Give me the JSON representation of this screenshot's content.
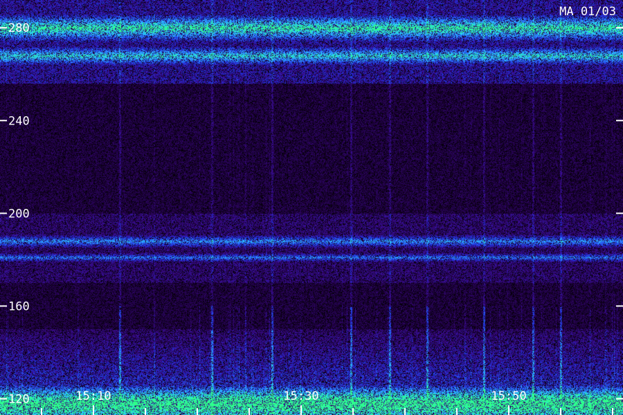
{
  "chart_data": {
    "type": "heatmap",
    "title": "MA 01/03",
    "xlabel": "",
    "ylabel": "",
    "y_axis": {
      "ticks": [
        120,
        160,
        200,
        240,
        280
      ],
      "range": [
        113,
        292
      ]
    },
    "x_axis": {
      "tick_labels": [
        "15:10",
        "15:30",
        "15:50"
      ],
      "tick_minutes": [
        10,
        30,
        50
      ],
      "range_minutes": [
        1,
        61
      ],
      "minor_step_minutes": 5
    },
    "colormap": [
      "#000000",
      "#1a0033",
      "#3a0a8a",
      "#1f2fd8",
      "#2e7bff",
      "#29d0ff",
      "#2eff8a"
    ],
    "bands": [
      {
        "center": 280,
        "width": 6,
        "intensity": 0.75
      },
      {
        "center": 268,
        "width": 4,
        "intensity": 0.6
      },
      {
        "center": 188,
        "width": 3,
        "intensity": 0.5
      },
      {
        "center": 181,
        "width": 2,
        "intensity": 0.45
      },
      {
        "center": 118,
        "width": 8,
        "intensity": 0.8
      }
    ],
    "streaks_minutes": [
      12.5,
      21.4,
      27.2,
      34.8,
      38.5,
      42.1,
      47.6,
      52.3,
      55.0
    ]
  }
}
